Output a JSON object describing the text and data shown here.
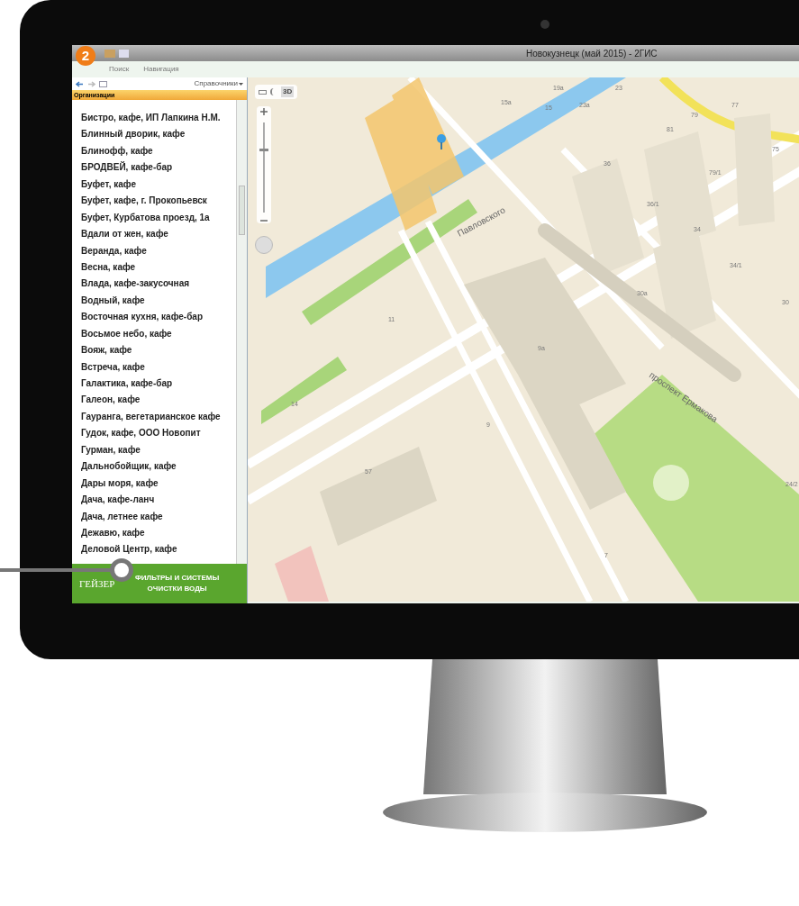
{
  "window": {
    "title": "Новокузнецк (май 2015) - 2ГИС",
    "logo": "2"
  },
  "ribbon_tabs": [
    {
      "label": "Поиск",
      "selected": false
    },
    {
      "label": "Навигация",
      "selected": false
    }
  ],
  "sidebar": {
    "toolbar_menu": "Справочники",
    "header": "Организации",
    "items": [
      "Бистро, кафе, ИП Лапкина Н.М.",
      "Блинный дворик, кафе",
      "Блинофф, кафе",
      "БРОДВЕЙ, кафе-бар",
      "Буфет, кафе",
      "Буфет, кафе, г. Прокопьевск",
      "Буфет, Курбатова проезд, 1а",
      "Вдали от жен, кафе",
      "Веранда, кафе",
      "Весна, кафе",
      "Влада, кафе-закусочная",
      "Водный, кафе",
      "Восточная кухня, кафе-бар",
      "Восьмое небо, кафе",
      "Вояж, кафе",
      "Встреча, кафе",
      "Галактика, кафе-бар",
      "Галеон, кафе",
      "Гауранга, вегетарианское кафе",
      "Гудок, кафе, ООО Новопит",
      "Гурман, кафе",
      "Дальнобойщик, кафе",
      "Дары моря, кафе",
      "Дача, кафе-ланч",
      "Дача, летнее кафе",
      "Дежавю, кафе",
      "Деловой Центр, кафе"
    ],
    "ad": {
      "logo": "ГЕЙЗЕР",
      "line_1": "ФИЛЬТРЫ И СИСТЕМЫ",
      "line_2": "ОЧИСТКИ ВОДЫ"
    }
  },
  "map": {
    "mode_button": "3D",
    "zoom": {
      "level": 0.7
    },
    "streets": [
      "Павловского",
      "проспект Ермакова"
    ],
    "house_numbers": [
      "19а",
      "23",
      "15а",
      "15",
      "23а",
      "77",
      "79",
      "81",
      "36",
      "75",
      "79/1",
      "36/1",
      "34",
      "34/1",
      "30а",
      "30",
      "11",
      "9а",
      "14",
      "9",
      "57",
      "24/2",
      "7"
    ]
  }
}
